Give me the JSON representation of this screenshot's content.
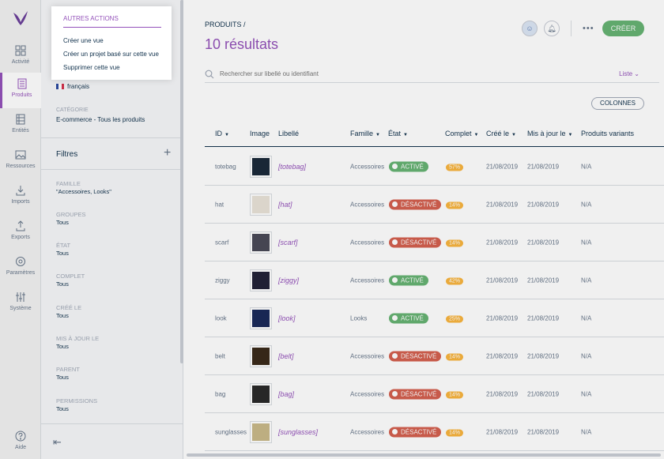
{
  "nav": {
    "items": [
      {
        "label": "Activité",
        "icon": "dashboard-icon"
      },
      {
        "label": "Produits",
        "icon": "products-icon",
        "active": true
      },
      {
        "label": "Entités",
        "icon": "entities-icon"
      },
      {
        "label": "Ressources",
        "icon": "assets-icon"
      },
      {
        "label": "Imports",
        "icon": "import-icon"
      },
      {
        "label": "Exports",
        "icon": "export-icon"
      },
      {
        "label": "Paramètres",
        "icon": "settings-icon"
      },
      {
        "label": "Système",
        "icon": "system-icon"
      }
    ],
    "help": "Aide"
  },
  "menu": {
    "title": "AUTRES ACTIONS",
    "items": [
      "Créer une vue",
      "Créer un projet basé sur cette vue",
      "Supprimer cette vue"
    ]
  },
  "panel": {
    "locale": "français",
    "category_label": "CATÉGORIE",
    "category_value": "E-commerce - Tous les produits",
    "filters_title": "Filtres",
    "filters": [
      {
        "label": "FAMILLE",
        "value": "\"Accessoires, Looks\""
      },
      {
        "label": "GROUPES",
        "value": "Tous"
      },
      {
        "label": "ÉTAT",
        "value": "Tous"
      },
      {
        "label": "COMPLET",
        "value": "Tous"
      },
      {
        "label": "CRÉÉ LE",
        "value": "Tous"
      },
      {
        "label": "MIS À JOUR LE",
        "value": "Tous"
      },
      {
        "label": "PARENT",
        "value": "Tous"
      },
      {
        "label": "PERMISSIONS",
        "value": "Tous"
      }
    ]
  },
  "main": {
    "breadcrumb": "PRODUITS /",
    "results": "10 résultats",
    "create": "CRÉER",
    "search_placeholder": "Rechercher sur libellé ou identifiant",
    "view": "Liste",
    "columns_btn": "COLONNES",
    "headers": [
      "ID",
      "Image",
      "Libellé",
      "Famille",
      "État",
      "Complet",
      "Créé le",
      "Mis à jour le",
      "Produits variants"
    ],
    "rows": [
      {
        "id": "totebag",
        "label": "[totebag]",
        "family": "Accessoires",
        "status": "ACTIVÉ",
        "state": "on",
        "complete": "57%",
        "created": "21/08/2019",
        "updated": "21/08/2019",
        "variants": "N/A"
      },
      {
        "id": "hat",
        "label": "[hat]",
        "family": "Accessoires",
        "status": "DÉSACTIVÉ",
        "state": "off",
        "complete": "14%",
        "created": "21/08/2019",
        "updated": "21/08/2019",
        "variants": "N/A"
      },
      {
        "id": "scarf",
        "label": "[scarf]",
        "family": "Accessoires",
        "status": "DÉSACTIVÉ",
        "state": "off",
        "complete": "14%",
        "created": "21/08/2019",
        "updated": "21/08/2019",
        "variants": "N/A"
      },
      {
        "id": "ziggy",
        "label": "[ziggy]",
        "family": "Accessoires",
        "status": "ACTIVÉ",
        "state": "on",
        "complete": "42%",
        "created": "21/08/2019",
        "updated": "21/08/2019",
        "variants": "N/A"
      },
      {
        "id": "look",
        "label": "[look]",
        "family": "Looks",
        "status": "ACTIVÉ",
        "state": "on",
        "complete": "25%",
        "created": "21/08/2019",
        "updated": "21/08/2019",
        "variants": "N/A"
      },
      {
        "id": "belt",
        "label": "[belt]",
        "family": "Accessoires",
        "status": "DÉSACTIVÉ",
        "state": "off",
        "complete": "14%",
        "created": "21/08/2019",
        "updated": "21/08/2019",
        "variants": "N/A"
      },
      {
        "id": "bag",
        "label": "[bag]",
        "family": "Accessoires",
        "status": "DÉSACTIVÉ",
        "state": "off",
        "complete": "14%",
        "created": "21/08/2019",
        "updated": "21/08/2019",
        "variants": "N/A"
      },
      {
        "id": "sunglasses",
        "label": "[sunglasses]",
        "family": "Accessoires",
        "status": "DÉSACTIVÉ",
        "state": "off",
        "complete": "14%",
        "created": "21/08/2019",
        "updated": "21/08/2019",
        "variants": "N/A"
      }
    ]
  },
  "colors": {
    "accent": "#9452ba",
    "active": "#67b373",
    "inactive": "#d4604f",
    "complete": "#f9b53f"
  }
}
